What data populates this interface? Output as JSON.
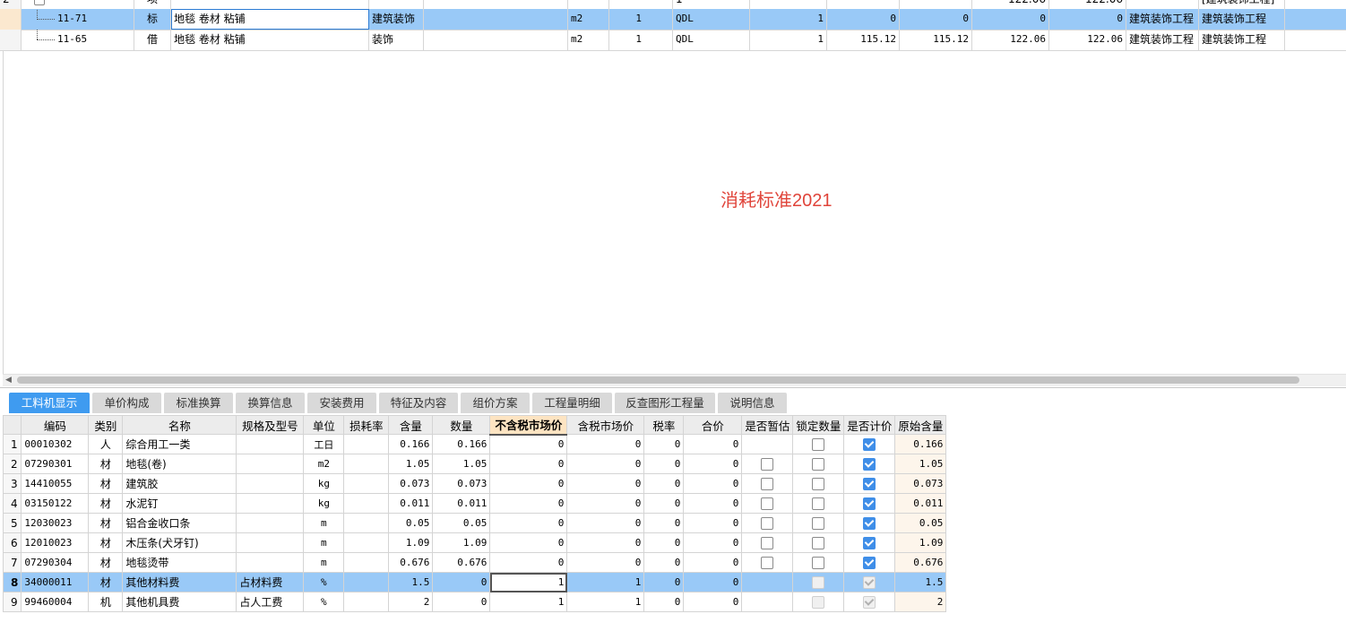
{
  "top_grid": {
    "partial_row": {
      "index": "2",
      "type": "项",
      "qty": "1",
      "val1": "122.06",
      "val2": "122.06",
      "major": "[建筑装饰工程]"
    },
    "rows": [
      {
        "code": "11-71",
        "kind": "标",
        "name": "地毯 卷材 粘铺",
        "category": "建筑装饰",
        "unit": "m2",
        "content": "1",
        "expr": "QDL",
        "qty": "1",
        "unit_price": "0",
        "total": "0",
        "tax_price": "0",
        "tax_total": "0",
        "major": "建筑装饰工程",
        "major2": "建筑装饰工程",
        "selected": true
      },
      {
        "code": "11-65",
        "kind": "借",
        "name": "地毯 卷材 粘铺",
        "category": "装饰",
        "unit": "m2",
        "content": "1",
        "expr": "QDL",
        "qty": "1",
        "unit_price": "115.12",
        "total": "115.12",
        "tax_price": "122.06",
        "tax_total": "122.06",
        "major": "建筑装饰工程",
        "major2": "建筑装饰工程",
        "selected": false
      }
    ]
  },
  "watermark": "消耗标准2021",
  "tabs": [
    "工料机显示",
    "单价构成",
    "标准换算",
    "换算信息",
    "安装费用",
    "特征及内容",
    "组价方案",
    "工程量明细",
    "反查图形工程量",
    "说明信息"
  ],
  "active_tab": "工料机显示",
  "bottom_grid": {
    "headers": [
      "",
      "编码",
      "类别",
      "名称",
      "规格及型号",
      "单位",
      "损耗率",
      "含量",
      "数量",
      "不含税市场价",
      "含税市场价",
      "税率",
      "合价",
      "是否暂估",
      "锁定数量",
      "是否计价",
      "原始含量"
    ],
    "rows": [
      {
        "idx": "1",
        "code": "00010302",
        "type": "人",
        "name": "综合用工一类",
        "spec": "",
        "unit": "工日",
        "loss": "",
        "content": "0.166",
        "qty": "0.166",
        "price": "0",
        "tax_price": "0",
        "tax_rate": "0",
        "total": "0",
        "provisional": "none",
        "locked": "unchecked",
        "priced": "checked",
        "orig": "0.166"
      },
      {
        "idx": "2",
        "code": "07290301",
        "type": "材",
        "name": "地毯(卷)",
        "spec": "",
        "unit": "m2",
        "loss": "",
        "content": "1.05",
        "qty": "1.05",
        "price": "0",
        "tax_price": "0",
        "tax_rate": "0",
        "total": "0",
        "provisional": "unchecked",
        "locked": "unchecked",
        "priced": "checked",
        "orig": "1.05"
      },
      {
        "idx": "3",
        "code": "14410055",
        "type": "材",
        "name": "建筑胶",
        "spec": "",
        "unit": "kg",
        "loss": "",
        "content": "0.073",
        "qty": "0.073",
        "price": "0",
        "tax_price": "0",
        "tax_rate": "0",
        "total": "0",
        "provisional": "unchecked",
        "locked": "unchecked",
        "priced": "checked",
        "orig": "0.073"
      },
      {
        "idx": "4",
        "code": "03150122",
        "type": "材",
        "name": "水泥钉",
        "spec": "",
        "unit": "kg",
        "loss": "",
        "content": "0.011",
        "qty": "0.011",
        "price": "0",
        "tax_price": "0",
        "tax_rate": "0",
        "total": "0",
        "provisional": "unchecked",
        "locked": "unchecked",
        "priced": "checked",
        "orig": "0.011"
      },
      {
        "idx": "5",
        "code": "12030023",
        "type": "材",
        "name": "铝合金收口条",
        "spec": "",
        "unit": "m",
        "loss": "",
        "content": "0.05",
        "qty": "0.05",
        "price": "0",
        "tax_price": "0",
        "tax_rate": "0",
        "total": "0",
        "provisional": "unchecked",
        "locked": "unchecked",
        "priced": "checked",
        "orig": "0.05"
      },
      {
        "idx": "6",
        "code": "12010023",
        "type": "材",
        "name": "木压条(犬牙钉)",
        "spec": "",
        "unit": "m",
        "loss": "",
        "content": "1.09",
        "qty": "1.09",
        "price": "0",
        "tax_price": "0",
        "tax_rate": "0",
        "total": "0",
        "provisional": "unchecked",
        "locked": "unchecked",
        "priced": "checked",
        "orig": "1.09"
      },
      {
        "idx": "7",
        "code": "07290304",
        "type": "材",
        "name": "地毯烫带",
        "spec": "",
        "unit": "m",
        "loss": "",
        "content": "0.676",
        "qty": "0.676",
        "price": "0",
        "tax_price": "0",
        "tax_rate": "0",
        "total": "0",
        "provisional": "unchecked",
        "locked": "unchecked",
        "priced": "checked",
        "orig": "0.676"
      },
      {
        "idx": "8",
        "code": "34000011",
        "type": "材",
        "name": "其他材料费",
        "spec": "占材料费",
        "unit": "%",
        "loss": "",
        "content": "1.5",
        "qty": "0",
        "price": "1",
        "tax_price": "1",
        "tax_rate": "0",
        "total": "0",
        "provisional": "none",
        "locked": "disabled",
        "priced": "disabled-checked",
        "orig": "1.5",
        "selected": true
      },
      {
        "idx": "9",
        "code": "99460004",
        "type": "机",
        "name": "其他机具费",
        "spec": "占人工费",
        "unit": "%",
        "loss": "",
        "content": "2",
        "qty": "0",
        "price": "1",
        "tax_price": "1",
        "tax_rate": "0",
        "total": "0",
        "provisional": "none",
        "locked": "disabled",
        "priced": "disabled-checked",
        "orig": "2"
      }
    ]
  }
}
